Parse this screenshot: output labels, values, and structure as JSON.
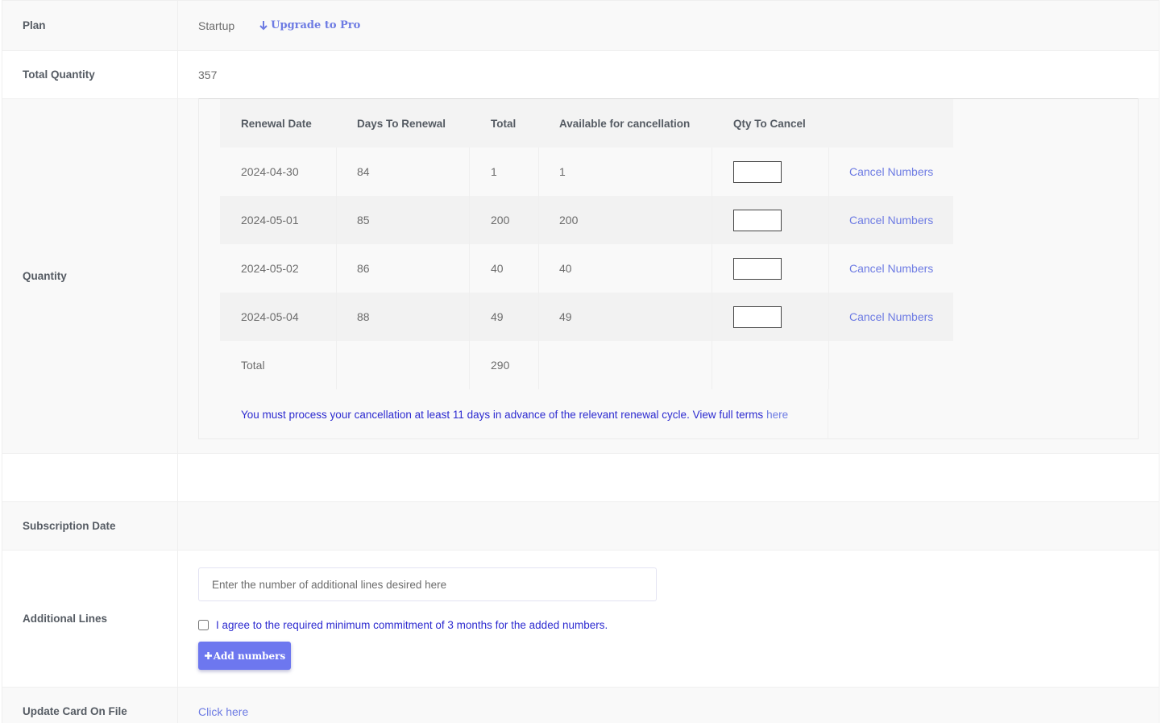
{
  "plan": {
    "label": "Plan",
    "value": "Startup",
    "upgrade_label": "Upgrade to Pro"
  },
  "total_quantity": {
    "label": "Total Quantity",
    "value": "357"
  },
  "quantity": {
    "label": "Quantity",
    "headers": [
      "Renewal Date",
      "Days To Renewal",
      "Total",
      "Available for cancellation",
      "Qty To Cancel"
    ],
    "rows": [
      {
        "date": "2024-04-30",
        "days": "84",
        "total": "1",
        "available": "1",
        "action": "Cancel Numbers"
      },
      {
        "date": "2024-05-01",
        "days": "85",
        "total": "200",
        "available": "200",
        "action": "Cancel Numbers"
      },
      {
        "date": "2024-05-02",
        "days": "86",
        "total": "40",
        "available": "40",
        "action": "Cancel Numbers"
      },
      {
        "date": "2024-05-04",
        "days": "88",
        "total": "49",
        "available": "49",
        "action": "Cancel Numbers"
      }
    ],
    "footer_label": "Total",
    "footer_total": "290",
    "note": "You must process your cancellation at least 11 days in advance of the relevant renewal cycle. View full terms",
    "note_link": "here"
  },
  "subscription_date": {
    "label": "Subscription Date",
    "value": ""
  },
  "additional_lines": {
    "label": "Additional Lines",
    "placeholder": "Enter the number of additional lines desired here",
    "agree_text": "I agree to the required minimum commitment of 3 months for the added numbers.",
    "button_label": "Add numbers"
  },
  "update_card": {
    "label": "Update Card On File",
    "link": "Click here"
  },
  "colors": {
    "accent": "#6d7be3",
    "button": "#6d77ef",
    "note_text": "#2d2bd0"
  }
}
